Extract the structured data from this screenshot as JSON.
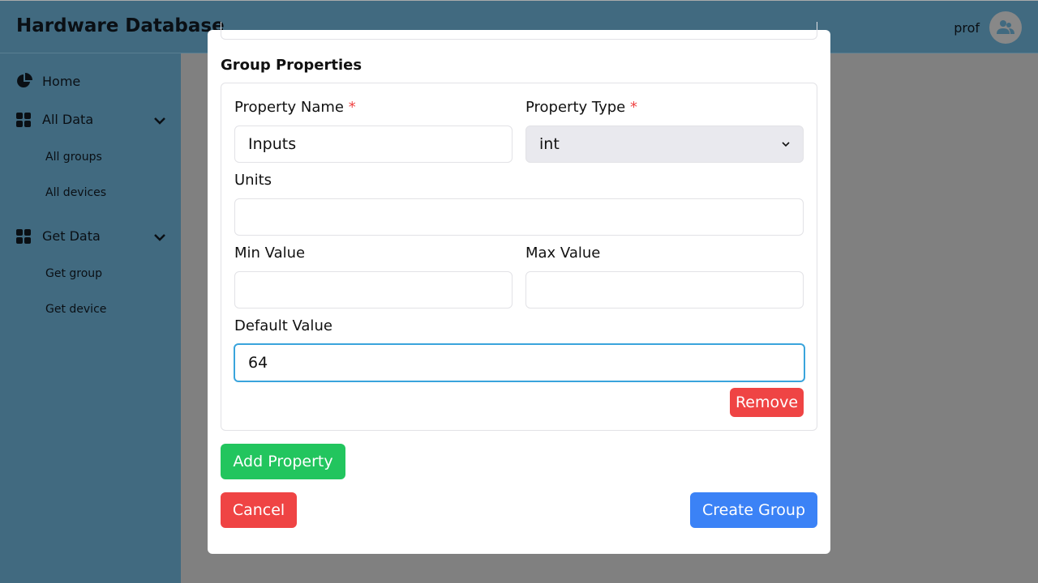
{
  "header": {
    "title": "Hardware Database",
    "user": "prof"
  },
  "sidebar": {
    "items": [
      {
        "label": "Home",
        "icon": "pie-chart-icon"
      },
      {
        "label": "All Data",
        "icon": "grid-icon",
        "children": [
          "All groups",
          "All devices"
        ]
      },
      {
        "label": "Get Data",
        "icon": "grid-icon",
        "children": [
          "Get group",
          "Get device"
        ]
      }
    ]
  },
  "modal": {
    "section_title": "Group Properties",
    "property": {
      "name_label": "Property Name",
      "name_value": "Inputs",
      "type_label": "Property Type",
      "type_value": "int",
      "required_mark": "*",
      "units_label": "Units",
      "units_value": "",
      "min_label": "Min Value",
      "min_value": "",
      "max_label": "Max Value",
      "max_value": "",
      "default_label": "Default Value",
      "default_value": "64",
      "remove_label": "Remove"
    },
    "add_property_label": "Add Property",
    "cancel_label": "Cancel",
    "create_label": "Create Group"
  },
  "colors": {
    "danger": "#ef4444",
    "success": "#22c55e",
    "primary": "#3b82f6",
    "focus": "#3aa4dc"
  }
}
